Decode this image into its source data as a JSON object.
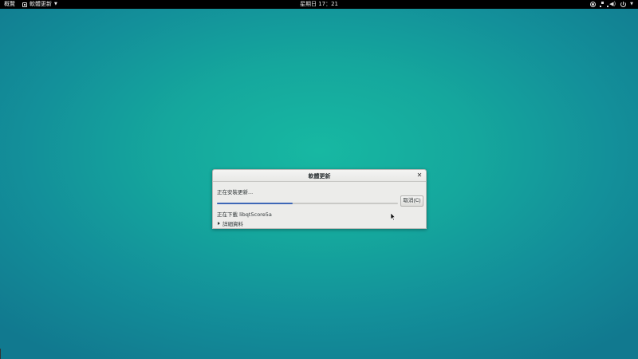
{
  "topbar": {
    "activities": "概覽",
    "app_name": "軟體更新",
    "clock": "星期日 17：21",
    "status_icons": [
      "screen-record-icon",
      "network-icon",
      "volume-icon",
      "power-icon"
    ]
  },
  "dialog": {
    "title": "軟體更新",
    "status": "正在安裝更新...",
    "progress": 0.42,
    "cancel_label": "取消(C)",
    "download_status": "正在下載 libqt5core5a",
    "details_label": "詳細資料"
  },
  "colors": {
    "accent": "#3e68b7",
    "desktop": "#15a79d"
  }
}
